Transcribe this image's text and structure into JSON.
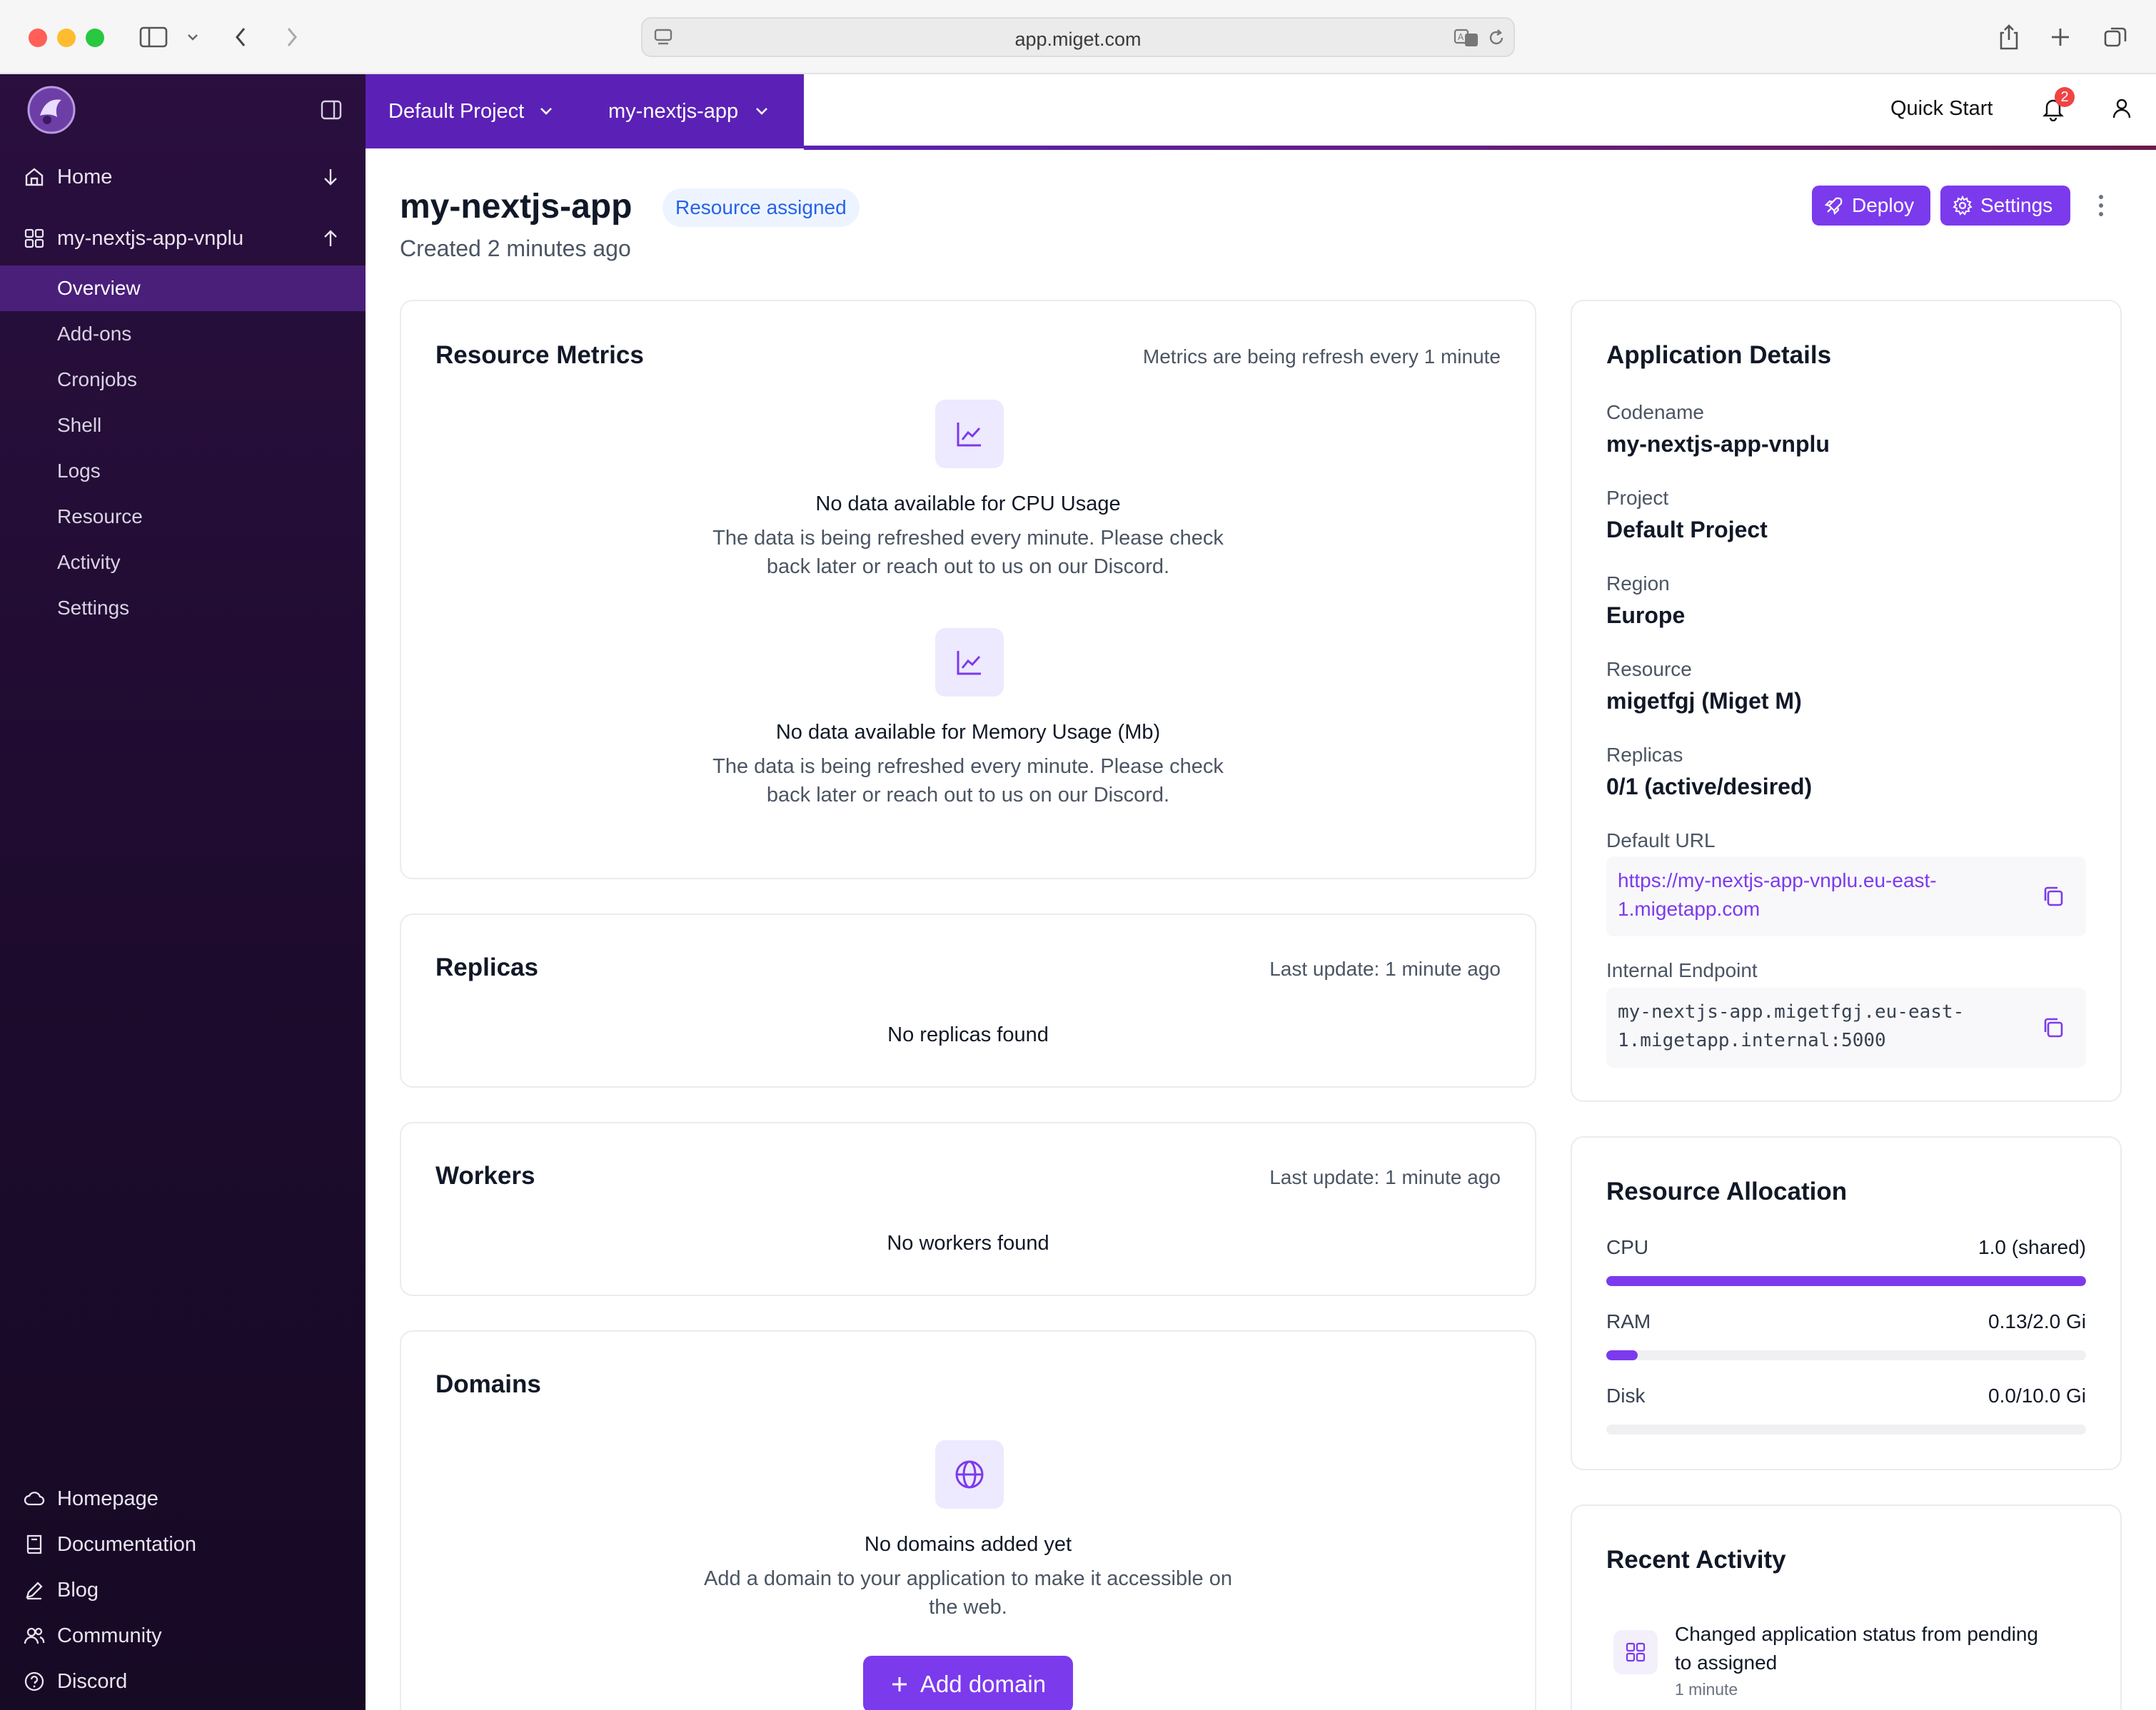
{
  "browser": {
    "url": "app.miget.com"
  },
  "sidebar": {
    "home": "Home",
    "app_name": "my-nextjs-app-vnplu",
    "items": [
      {
        "label": "Overview",
        "active": true
      },
      {
        "label": "Add-ons"
      },
      {
        "label": "Cronjobs"
      },
      {
        "label": "Shell"
      },
      {
        "label": "Logs"
      },
      {
        "label": "Resource"
      },
      {
        "label": "Activity"
      },
      {
        "label": "Settings"
      }
    ],
    "footer": [
      {
        "label": "Homepage",
        "icon": "cloud-icon"
      },
      {
        "label": "Documentation",
        "icon": "book-icon"
      },
      {
        "label": "Blog",
        "icon": "pen-icon"
      },
      {
        "label": "Community",
        "icon": "users-icon"
      },
      {
        "label": "Discord",
        "icon": "help-circle-icon"
      }
    ]
  },
  "topbar": {
    "project": "Default Project",
    "app": "my-nextjs-app",
    "quick_start": "Quick Start",
    "notifications": "2"
  },
  "header": {
    "title": "my-nextjs-app",
    "status": "Resource assigned",
    "created": "Created 2 minutes ago",
    "deploy": "Deploy",
    "settings": "Settings"
  },
  "metrics": {
    "title": "Resource Metrics",
    "refresh": "Metrics are being refresh every 1 minute",
    "cpu_title": "No data available for CPU Usage",
    "cpu_desc_1": "The data is being refreshed every minute. Please check",
    "cpu_desc_2": "back later or reach out to us on our Discord.",
    "mem_title": "No data available for Memory Usage (Mb)",
    "mem_desc_1": "The data is being refreshed every minute. Please check",
    "mem_desc_2": "back later or reach out to us on our Discord."
  },
  "replicas": {
    "title": "Replicas",
    "updated": "Last update: 1 minute ago",
    "empty": "No replicas found"
  },
  "workers": {
    "title": "Workers",
    "updated": "Last update: 1 minute ago",
    "empty": "No workers found"
  },
  "domains": {
    "title": "Domains",
    "empty_title": "No domains added yet",
    "empty_desc_1": "Add a domain to your application to make it accessible on",
    "empty_desc_2": "the web.",
    "add_button": "Add domain"
  },
  "details": {
    "title": "Application Details",
    "codename_label": "Codename",
    "codename": "my-nextjs-app-vnplu",
    "project_label": "Project",
    "project": "Default Project",
    "region_label": "Region",
    "region": "Europe",
    "resource_label": "Resource",
    "resource": "migetfgj (Miget M)",
    "replicas_label": "Replicas",
    "replicas": "0/1 (active/desired)",
    "url_label": "Default URL",
    "url_line_1": "https://my-nextjs-app-vnplu.eu-east-",
    "url_line_2": "1.migetapp.com",
    "endpoint_label": "Internal Endpoint",
    "endpoint_line_1": "my-nextjs-app.migetfgj.eu-east-",
    "endpoint_line_2": "1.migetapp.internal:5000"
  },
  "allocation": {
    "title": "Resource Allocation",
    "rows": [
      {
        "label": "CPU",
        "value": "1.0 (shared)",
        "fill": 1.0
      },
      {
        "label": "RAM",
        "value": "0.13/2.0 Gi",
        "fill": 0.065
      },
      {
        "label": "Disk",
        "value": "0.0/10.0 Gi",
        "fill": 0.0
      }
    ]
  },
  "activity": {
    "title": "Recent Activity",
    "item_line_1": "Changed application status from pending",
    "item_line_2": "to assigned",
    "item_time": "1 minute"
  },
  "colors": {
    "accent": "#7c3aed",
    "sidebar": "#2a0f3f",
    "badge": "#2563eb"
  }
}
